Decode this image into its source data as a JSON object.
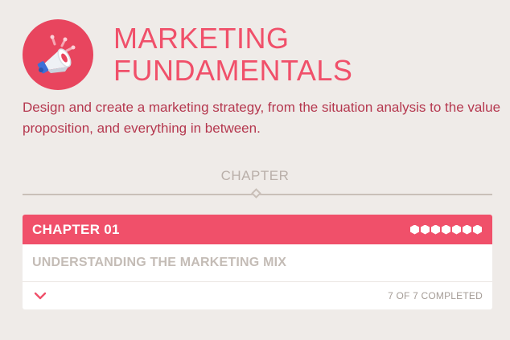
{
  "course": {
    "logo_icon": "megaphone-icon",
    "title_line1": "MARKETING",
    "title_line2": "FUNDAMENTALS",
    "description": "Design and create a marketing strategy, from the situation analysis to the value proposition, and everything in between."
  },
  "section": {
    "label": "CHAPTER"
  },
  "chapters": [
    {
      "number_label": "CHAPTER 01",
      "title": "UNDERSTANDING THE MARKETING MIX",
      "lessons_total": 7,
      "lessons_completed": 7,
      "completion_text": "7 OF 7 COMPLETED",
      "expand_icon": "chevron-down-icon"
    }
  ],
  "colors": {
    "accent": "#f0506a",
    "logo_bg": "#e8455e",
    "description_text": "#b5384f",
    "background": "#efebe8",
    "muted_text": "#c4bcb6"
  }
}
